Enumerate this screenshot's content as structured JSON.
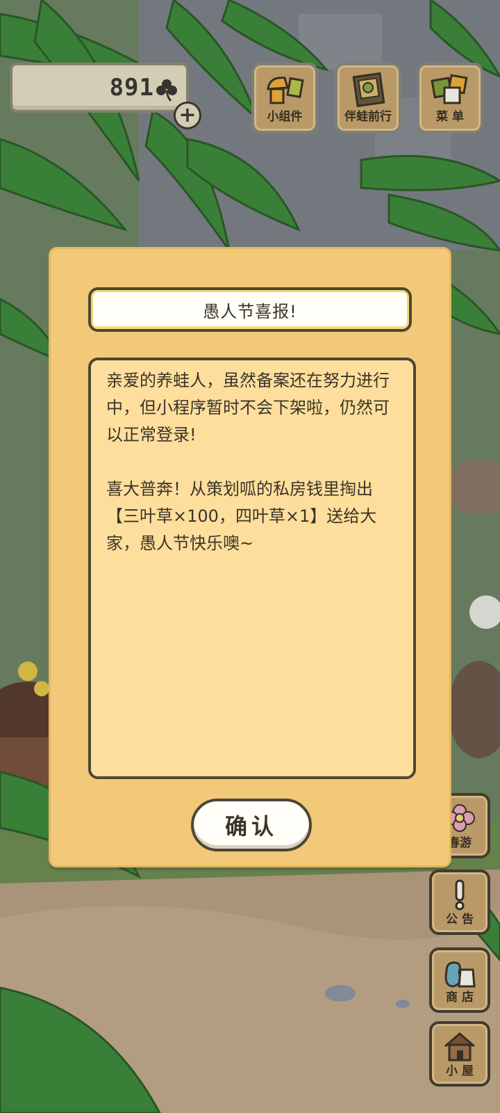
{
  "hud": {
    "currency_value": "891",
    "currency_icon": "clover-icon",
    "plus_label": "+"
  },
  "top_buttons": [
    {
      "label": "小组件",
      "icon": "widget-icon"
    },
    {
      "label": "伴蛙前行",
      "icon": "journey-book-icon"
    },
    {
      "label": "菜 单",
      "icon": "menu-cards-icon"
    }
  ],
  "side_buttons": [
    {
      "label": "春游",
      "icon": "flower-icon"
    },
    {
      "label": "公 告",
      "icon": "exclamation-icon"
    },
    {
      "label": "商 店",
      "icon": "shop-bags-icon"
    },
    {
      "label": "小 屋",
      "icon": "house-icon"
    }
  ],
  "dialog": {
    "title": "愚人节喜报!",
    "body": "亲爱的养蛙人，虽然备案还在努力进行中，但小程序暂时不会下架啦，仍然可以正常登录!\n\n喜大普奔！从策划呱的私房钱里掏出【三叶草×100，四叶草×1】送给大家，愚人节快乐噢~",
    "confirm_label": "确认"
  },
  "colors": {
    "dialog_bg": "#f1c978",
    "body_bg": "#fede9d",
    "outline": "#4e4636",
    "button_wood": "#c9a770"
  }
}
